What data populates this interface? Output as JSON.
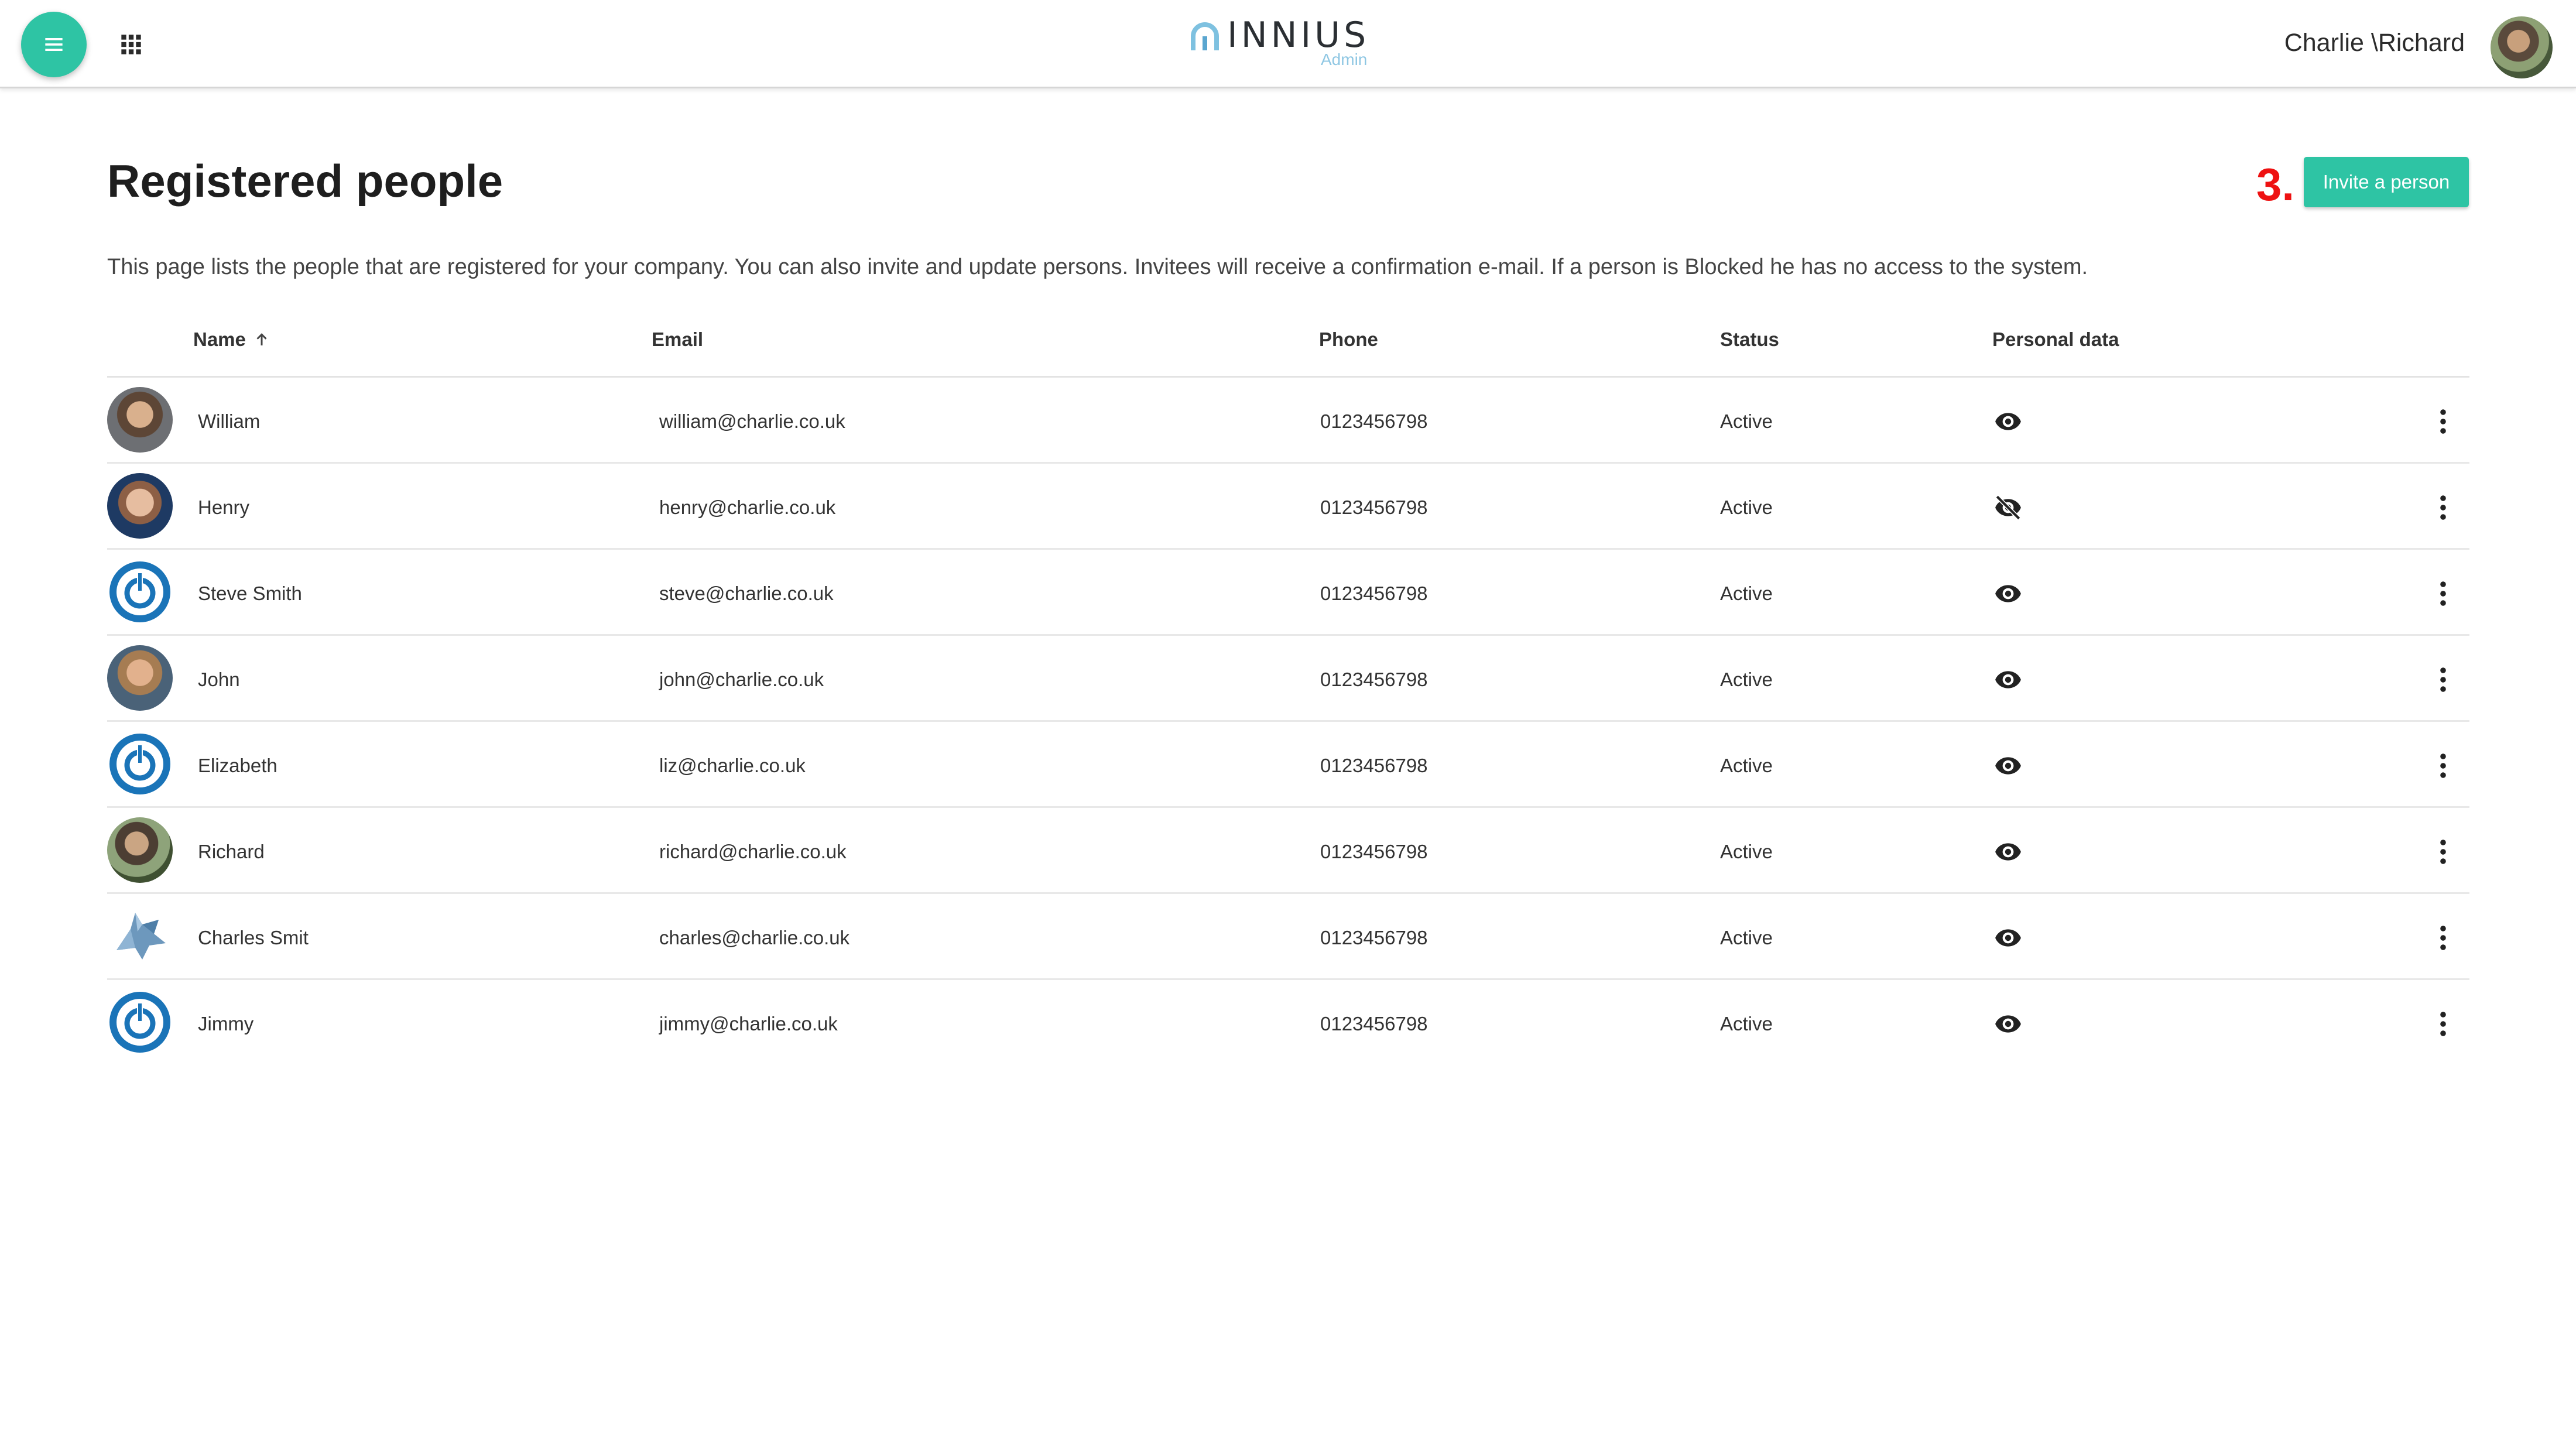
{
  "colors": {
    "accent": "#2ec4a4",
    "step_marker": "#ee1111",
    "logo_sub": "#8fc7e3",
    "power_avatar": "#1a74b8"
  },
  "header": {
    "menu_icon": "hamburger-icon",
    "apps_icon": "grid-apps-icon",
    "logo_text": "INNIUS",
    "logo_sub": "Admin",
    "user_name": "Charlie \\Richard"
  },
  "main": {
    "title": "Registered people",
    "step_marker": "3.",
    "invite_button": "Invite a person",
    "description": "This page lists the people that are registered for your company. You can also invite and update persons. Invitees will receive a confirmation e-mail. If a person is Blocked he has no access to the system."
  },
  "table": {
    "columns": {
      "name": "Name",
      "email": "Email",
      "phone": "Phone",
      "status": "Status",
      "personal_data": "Personal data"
    },
    "sort": "Name ascending",
    "rows": [
      {
        "name": "William",
        "email": "william@charlie.co.uk",
        "phone": "0123456798",
        "status": "Active",
        "avatar": "photo",
        "personal_data_visible": true
      },
      {
        "name": "Henry",
        "email": "henry@charlie.co.uk",
        "phone": "0123456798",
        "status": "Active",
        "avatar": "photo",
        "personal_data_visible": false
      },
      {
        "name": "Steve Smith",
        "email": "steve@charlie.co.uk",
        "phone": "0123456798",
        "status": "Active",
        "avatar": "power-logo",
        "personal_data_visible": true
      },
      {
        "name": "John",
        "email": "john@charlie.co.uk",
        "phone": "0123456798",
        "status": "Active",
        "avatar": "photo",
        "personal_data_visible": true
      },
      {
        "name": "Elizabeth",
        "email": "liz@charlie.co.uk",
        "phone": "0123456798",
        "status": "Active",
        "avatar": "power-logo",
        "personal_data_visible": true
      },
      {
        "name": "Richard",
        "email": "richard@charlie.co.uk",
        "phone": "0123456798",
        "status": "Active",
        "avatar": "photo",
        "personal_data_visible": true
      },
      {
        "name": "Charles Smit",
        "email": "charles@charlie.co.uk",
        "phone": "0123456798",
        "status": "Active",
        "avatar": "wolf-logo",
        "personal_data_visible": true
      },
      {
        "name": "Jimmy",
        "email": "jimmy@charlie.co.uk",
        "phone": "0123456798",
        "status": "Active",
        "avatar": "power-logo",
        "personal_data_visible": true
      }
    ]
  }
}
